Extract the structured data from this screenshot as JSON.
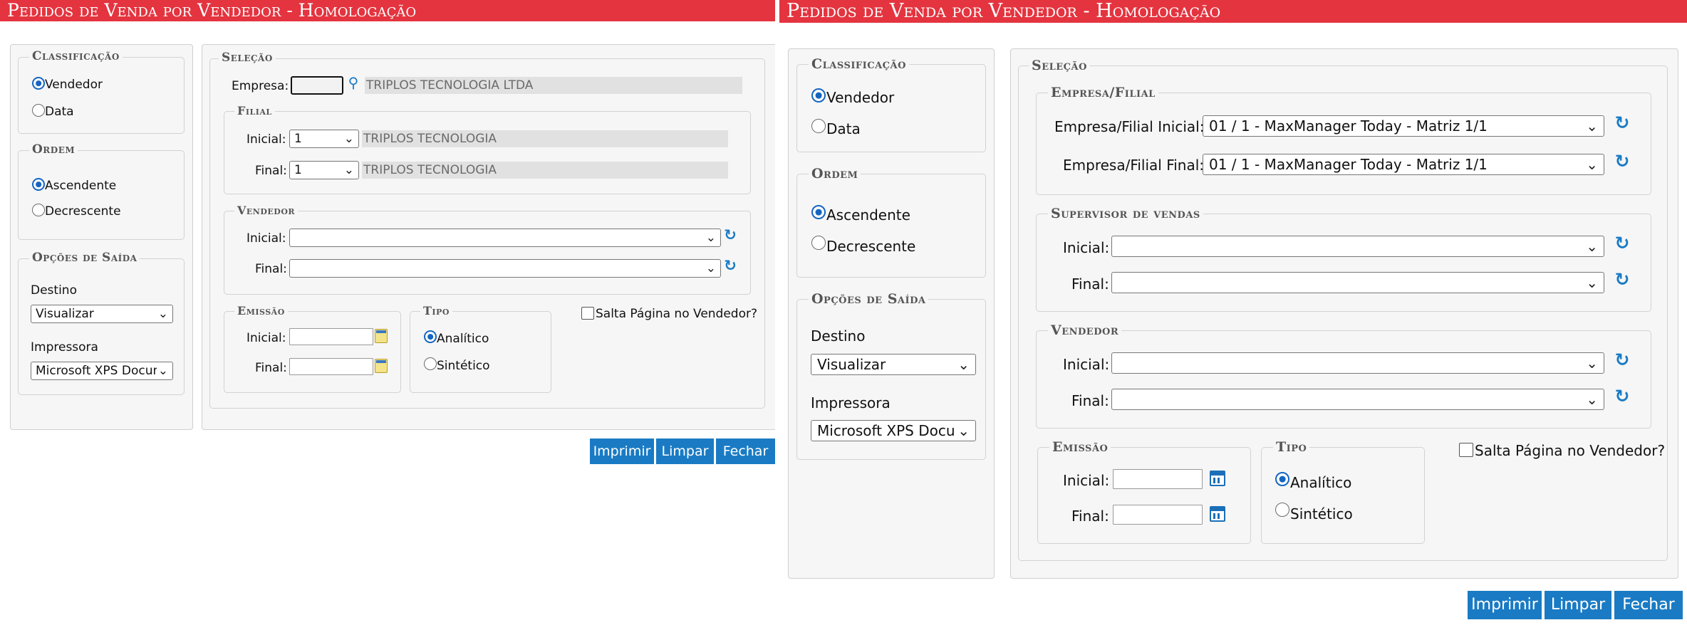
{
  "window": {
    "title": "Pedidos de Venda por Vendedor  - Homologação"
  },
  "classificacao": {
    "title": "Classificação",
    "options": [
      {
        "label": "Vendedor",
        "checked": true
      },
      {
        "label": "Data",
        "checked": false
      }
    ]
  },
  "ordem": {
    "title": "Ordem",
    "options": [
      {
        "label": "Ascendente",
        "checked": true
      },
      {
        "label": "Decrescente",
        "checked": false
      }
    ]
  },
  "opcoes_saida": {
    "title": "Opções de Saída",
    "destino_label": "Destino",
    "destino_value": "Visualizar",
    "impressora_label": "Impressora",
    "impressora_value": "Microsoft XPS Document Writer"
  },
  "selecao": {
    "title": "Seleção"
  },
  "left": {
    "empresa_label": "Empresa:",
    "empresa_name": "TRIPLOS TECNOLOGIA LTDA",
    "filial_title": "Filial",
    "filial_inicial_label": "Inicial:",
    "filial_inicial_value": "1",
    "filial_inicial_name": "TRIPLOS TECNOLOGIA",
    "filial_final_label": "Final:",
    "filial_final_value": "1",
    "filial_final_name": "TRIPLOS TECNOLOGIA"
  },
  "right": {
    "empresa_filial_title": "Empresa/Filial",
    "empresa_filial_inicial_label": "Empresa/Filial Inicial:",
    "empresa_filial_inicial_value": "01 / 1 - MaxManager Today - Matriz 1/1",
    "empresa_filial_final_label": "Empresa/Filial Final:",
    "empresa_filial_final_value": "01 / 1 - MaxManager Today - Matriz 1/1",
    "supervisor_title": "Supervisor de vendas",
    "supervisor_inicial_label": "Inicial:",
    "supervisor_final_label": "Final:"
  },
  "vendedor": {
    "title": "Vendedor",
    "inicial_label": "Inicial:",
    "final_label": "Final:"
  },
  "emissao": {
    "title": "Emissão",
    "inicial_label": "Inicial:",
    "final_label": "Final:"
  },
  "tipo": {
    "title": "Tipo",
    "options": [
      {
        "label": "Analítico",
        "checked": true
      },
      {
        "label": "Sintético",
        "checked": false
      }
    ]
  },
  "salta_pagina": {
    "label": "Salta Página no Vendedor?",
    "checked": false
  },
  "buttons": {
    "imprimir": "Imprimir",
    "limpar": "Limpar",
    "fechar": "Fechar"
  }
}
